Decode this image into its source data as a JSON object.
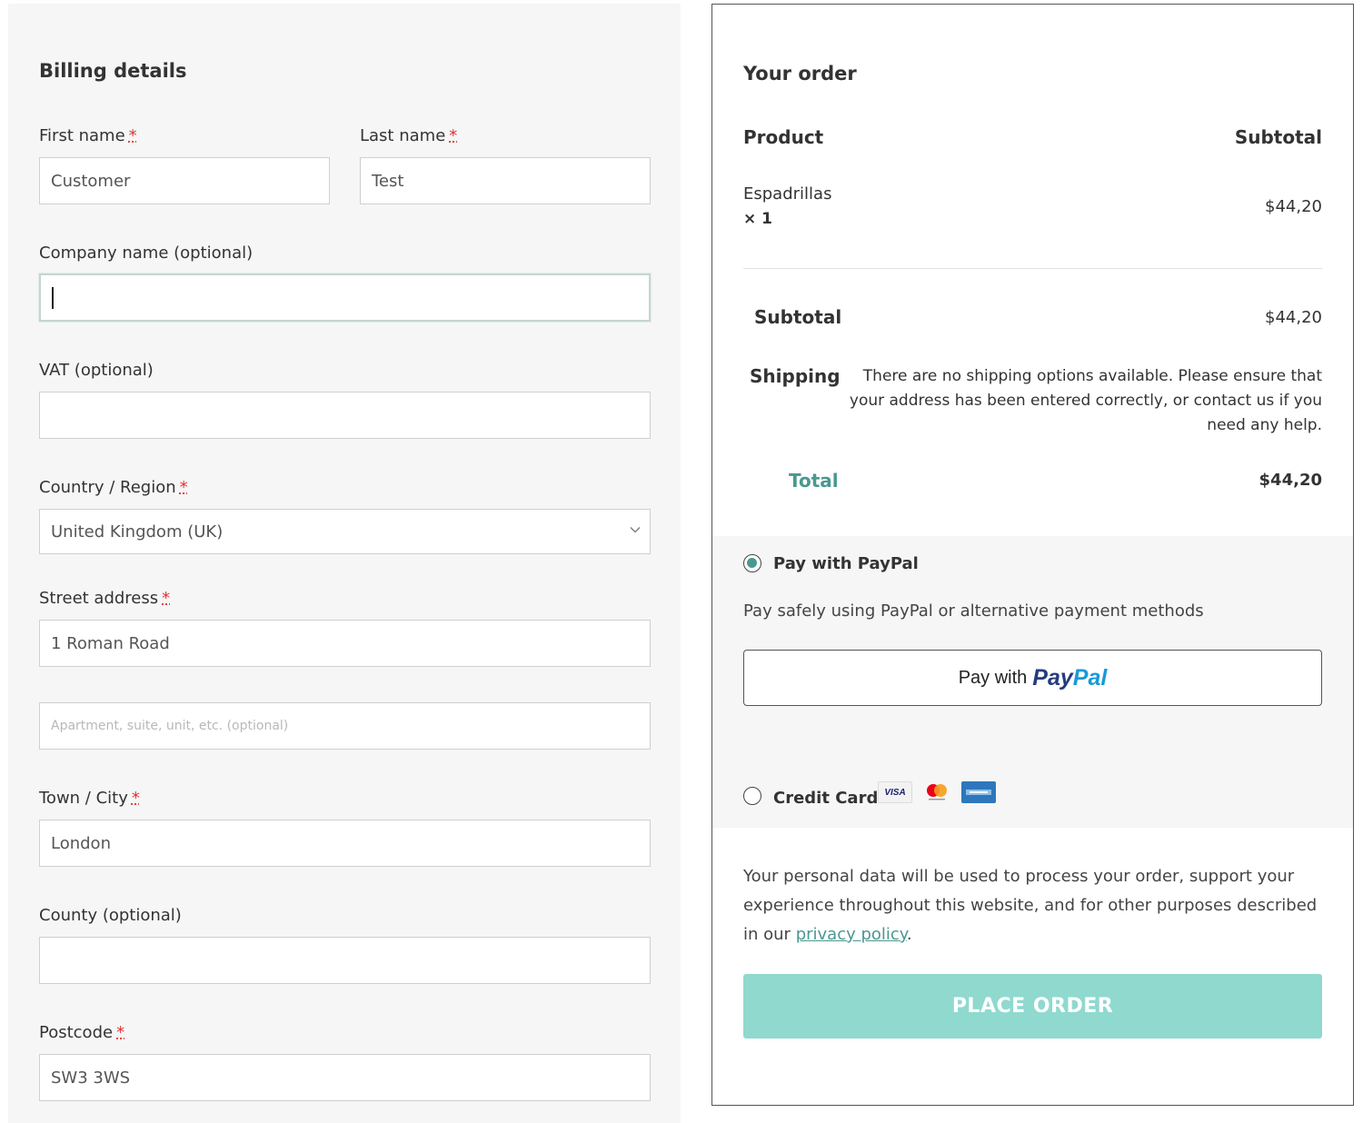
{
  "billing": {
    "title": "Billing details",
    "required_mark": "*",
    "first_name": {
      "label": "First name",
      "value": "Customer"
    },
    "last_name": {
      "label": "Last name",
      "value": "Test"
    },
    "company": {
      "label": "Company name (optional)",
      "value": ""
    },
    "vat": {
      "label": "VAT (optional)",
      "value": ""
    },
    "country": {
      "label": "Country / Region",
      "value": "United Kingdom (UK)"
    },
    "street": {
      "label": "Street address",
      "value": "1 Roman Road",
      "line2_placeholder": "Apartment, suite, unit, etc. (optional)"
    },
    "city": {
      "label": "Town / City",
      "value": "London"
    },
    "county": {
      "label": "County (optional)",
      "value": ""
    },
    "postcode": {
      "label": "Postcode",
      "value": "SW3 3WS"
    }
  },
  "order": {
    "title": "Your order",
    "col_product": "Product",
    "col_subtotal": "Subtotal",
    "items": [
      {
        "name": "Espadrillas",
        "qty": "× 1",
        "price": "$44,20"
      }
    ],
    "subtotal_label": "Subtotal",
    "subtotal_value": "$44,20",
    "shipping_label": "Shipping",
    "shipping_text": "There are no shipping options available. Please ensure that your address has been entered correctly, or contact us if you need any help.",
    "total_label": "Total",
    "total_value": "$44,20"
  },
  "payment": {
    "paypal_label": "Pay with PayPal",
    "paypal_desc": "Pay safely using PayPal or alternative payment methods",
    "paypal_button_prefix": "Pay with",
    "paypal_logo_a": "Pay",
    "paypal_logo_b": "Pal",
    "card_label": "Credit Card",
    "card_icons": [
      "visa-icon",
      "mastercard-icon",
      "amex-icon"
    ],
    "visa_text": "VISA",
    "selected": "paypal"
  },
  "privacy": {
    "text_before": "Your personal data will be used to process your order, support your experience throughout this website, and for other purposes described in our ",
    "link": "privacy policy",
    "text_after": "."
  },
  "place_order": "PLACE ORDER",
  "colors": {
    "accent": "#4a9890",
    "place_order_bg": "#8fd9cf",
    "required": "#dd3333",
    "paypal_dark": "#253b80",
    "paypal_light": "#179bd7"
  }
}
